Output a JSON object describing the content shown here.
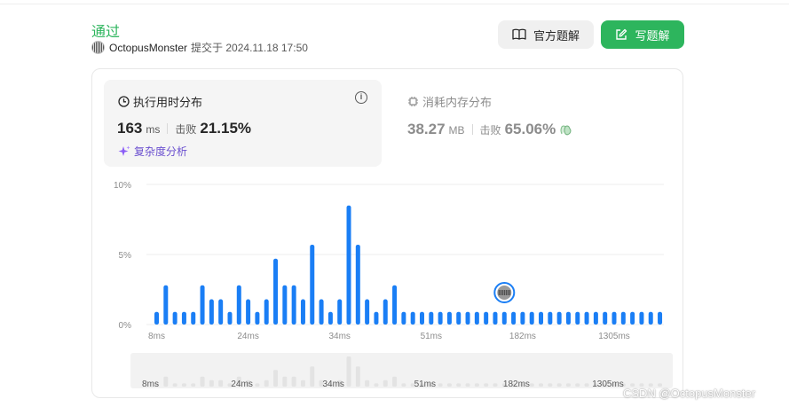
{
  "status": "通过",
  "submission": {
    "user": "OctopusMonster",
    "submitted_text": "提交于 2024.11.18 17:50"
  },
  "buttons": {
    "official_solution": "官方题解",
    "write_solution": "写题解"
  },
  "runtime": {
    "title": "执行用时分布",
    "value": "163",
    "unit": "ms",
    "beat_label": "击败",
    "beat_pct": "21.15%",
    "complexity_link": "复杂度分析"
  },
  "memory": {
    "title": "消耗内存分布",
    "value": "38.27",
    "unit": "MB",
    "beat_label": "击败",
    "beat_pct": "65.06%"
  },
  "colors": {
    "accent_green": "#2db55d",
    "bar_blue": "#1a7ef5",
    "panel_bg": "#f5f5f5",
    "muted_bar": "#e3e3e3"
  },
  "chart_data": {
    "type": "bar",
    "ylabel": "",
    "xlabel": "",
    "y_ticks": [
      "10%",
      "5%",
      "0%"
    ],
    "ylim": [
      0,
      10
    ],
    "x_tick_labels": [
      "8ms",
      "24ms",
      "34ms",
      "51ms",
      "182ms",
      "1305ms"
    ],
    "x_tick_bar_index": [
      0,
      10,
      20,
      30,
      40,
      50
    ],
    "values": [
      0.9,
      2.8,
      0.9,
      0.9,
      0.9,
      2.8,
      1.8,
      1.8,
      0.9,
      2.8,
      1.8,
      0.9,
      1.8,
      4.7,
      2.8,
      2.8,
      1.8,
      5.7,
      1.8,
      0.9,
      1.8,
      8.5,
      5.7,
      1.8,
      0.9,
      1.8,
      2.8,
      0.9,
      0.9,
      0.9,
      0.9,
      0.9,
      0.9,
      0.9,
      0.9,
      0.9,
      0.9,
      0.9,
      0.9,
      0.9,
      0.9,
      0.9,
      0.9,
      0.9,
      0.9,
      0.9,
      0.9,
      0.9,
      0.9,
      0.9,
      0.9,
      0.9,
      0.9,
      0.9,
      0.9,
      0.9
    ],
    "highlight_index": 38,
    "grid": true
  },
  "overview": {
    "tick_labels": [
      "8ms",
      "24ms",
      "34ms",
      "51ms",
      "182ms",
      "1305ms"
    ]
  },
  "watermark": "CSDN @OctopusMonster"
}
